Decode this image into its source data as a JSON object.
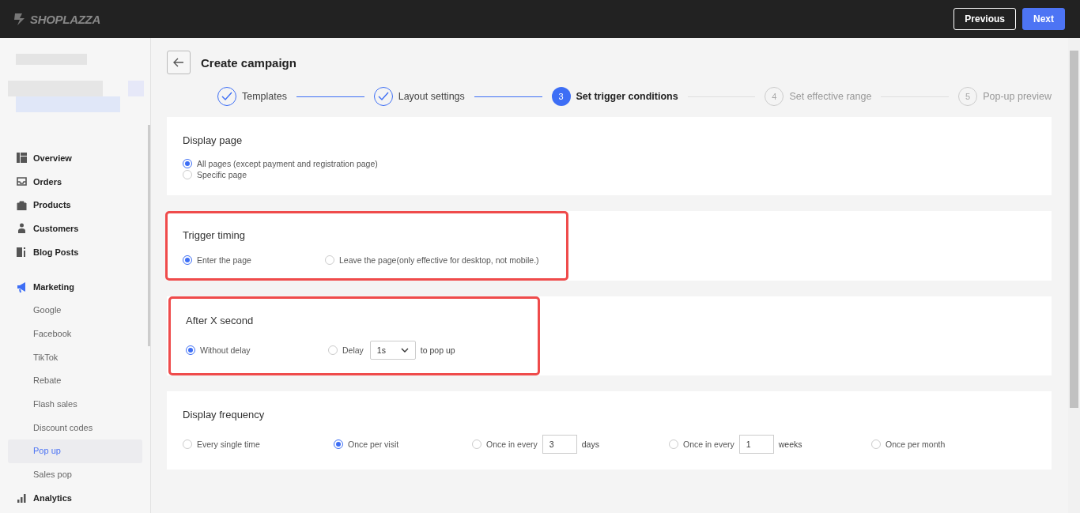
{
  "header": {
    "logo": "SHOPLAZZA",
    "buttons": [
      {
        "label": "Previous",
        "kind": "secondary"
      },
      {
        "label": "Next",
        "kind": "primary"
      }
    ]
  },
  "sidebar": {
    "items": [
      {
        "label": "Overview",
        "selected": false
      },
      {
        "label": "Orders",
        "selected": false
      },
      {
        "label": "Products",
        "selected": false
      },
      {
        "label": "Customers",
        "selected": false
      },
      {
        "label": "Blog Posts",
        "selected": false
      },
      {
        "label": "Marketing",
        "selected": false,
        "children": [
          {
            "label": "Google",
            "selected": false
          },
          {
            "label": "Facebook",
            "selected": false
          },
          {
            "label": "TikTok",
            "selected": false
          },
          {
            "label": "Rebate",
            "selected": false
          },
          {
            "label": "Flash sales",
            "selected": false
          },
          {
            "label": "Discount codes",
            "selected": false
          },
          {
            "label": "Pop up",
            "selected": true
          },
          {
            "label": "Sales pop",
            "selected": false
          }
        ]
      },
      {
        "label": "Analytics",
        "selected": false
      }
    ]
  },
  "page_title": "Create campaign",
  "steps": [
    {
      "label": "Templates",
      "completed": true,
      "selected": false
    },
    {
      "label": "Layout settings",
      "completed": true,
      "selected": false
    },
    {
      "number": "3",
      "label": "Set trigger conditions",
      "completed": false,
      "selected": true
    },
    {
      "number": "4",
      "label": "Set effective range",
      "completed": false,
      "selected": false
    },
    {
      "number": "5",
      "label": "Pop-up preview",
      "completed": false,
      "selected": false
    }
  ],
  "sections": [
    {
      "title": "Display page",
      "highlighted": false,
      "options": [
        {
          "kind": "radio",
          "label": "All pages (except payment and registration page)",
          "selected": true
        },
        {
          "kind": "radio",
          "label": "Specific page",
          "selected": false
        }
      ]
    },
    {
      "title": "Trigger timing",
      "highlighted": true,
      "options": [
        {
          "kind": "radio",
          "label": "Enter the page",
          "selected": true
        },
        {
          "kind": "radio",
          "label": "Leave the page(only effective for desktop, not mobile.)",
          "selected": false
        }
      ]
    },
    {
      "title": "After X second",
      "highlighted": true,
      "options": [
        {
          "kind": "radio",
          "label": "Without delay",
          "selected": true
        },
        {
          "kind": "select",
          "label": "Delay",
          "value": "1s",
          "suffix": "to pop up",
          "selected": false
        }
      ]
    },
    {
      "title": "Display frequency",
      "highlighted": false,
      "options": [
        {
          "kind": "radio",
          "label": "Every single time",
          "selected": false
        },
        {
          "kind": "radio",
          "label": "Once per visit",
          "selected": true
        },
        {
          "kind": "input",
          "label": "Once in every",
          "value": "3",
          "suffix": "days",
          "selected": false
        },
        {
          "kind": "input",
          "label": "Once in every",
          "value": "1",
          "suffix": "weeks",
          "selected": false
        },
        {
          "kind": "radio",
          "label": "Once per month",
          "selected": false
        }
      ]
    }
  ]
}
